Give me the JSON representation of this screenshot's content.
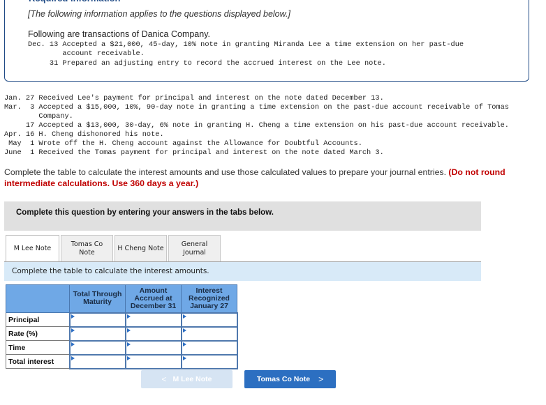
{
  "info_box": {
    "heading": "Required information",
    "italic_note": "[The following information applies to the questions displayed below.]",
    "intro": "Following are transactions of Danica Company.",
    "lines_top": [
      "Dec. 13 Accepted a $21,000, 45-day, 10% note in granting Miranda Lee a time extension on her past-due",
      "        account receivable.",
      "     31 Prepared an adjusting entry to record the accrued interest on the Lee note."
    ]
  },
  "transactions": [
    "Jan. 27 Received Lee's payment for principal and interest on the note dated December 13.",
    "Mar.  3 Accepted a $15,000, 10%, 90-day note in granting a time extension on the past-due account receivable of Tomas",
    "        Company.",
    "     17 Accepted a $13,000, 30-day, 6% note in granting H. Cheng a time extension on his past-due account receivable.",
    "Apr. 16 H. Cheng dishonored his note.",
    " May  1 Wrote off the H. Cheng account against the Allowance for Doubtful Accounts.",
    "June  1 Received the Tomas payment for principal and interest on the note dated March 3."
  ],
  "instruction": {
    "text": "Complete the table to calculate the interest amounts and use those calculated values to prepare your journal entries. ",
    "emphasis": "(Do not round intermediate calculations. Use 360 days a year.)"
  },
  "prompt_box": {
    "text": "Complete this question by entering your answers in the tabs below."
  },
  "tabs": [
    {
      "label": "M Lee Note",
      "active": true
    },
    {
      "label": "Tomas Co Note",
      "active": false
    },
    {
      "label": "H Cheng Note",
      "active": false
    },
    {
      "label": "General Journal",
      "active": false
    }
  ],
  "tab_instruction": "Complete the table to calculate the interest amounts.",
  "table": {
    "columns": [
      "",
      "Total Through Maturity",
      "Amount Accrued at December 31",
      "Interest Recognized January 27"
    ],
    "rows": [
      {
        "label": "Principal",
        "values": [
          "",
          "",
          ""
        ]
      },
      {
        "label": "Rate (%)",
        "values": [
          "",
          "",
          ""
        ]
      },
      {
        "label": "Time",
        "values": [
          "",
          "",
          ""
        ]
      },
      {
        "label": "Total interest",
        "values": [
          "",
          "",
          ""
        ]
      }
    ]
  },
  "nav": {
    "prev_label": "M Lee Note",
    "prev_icon": "chevron-left-icon",
    "next_label": "Tomas Co Note",
    "next_icon": "chevron-right-icon",
    "accent_color": "#2c6fc1",
    "disabled_color": "#d6e4f3"
  }
}
